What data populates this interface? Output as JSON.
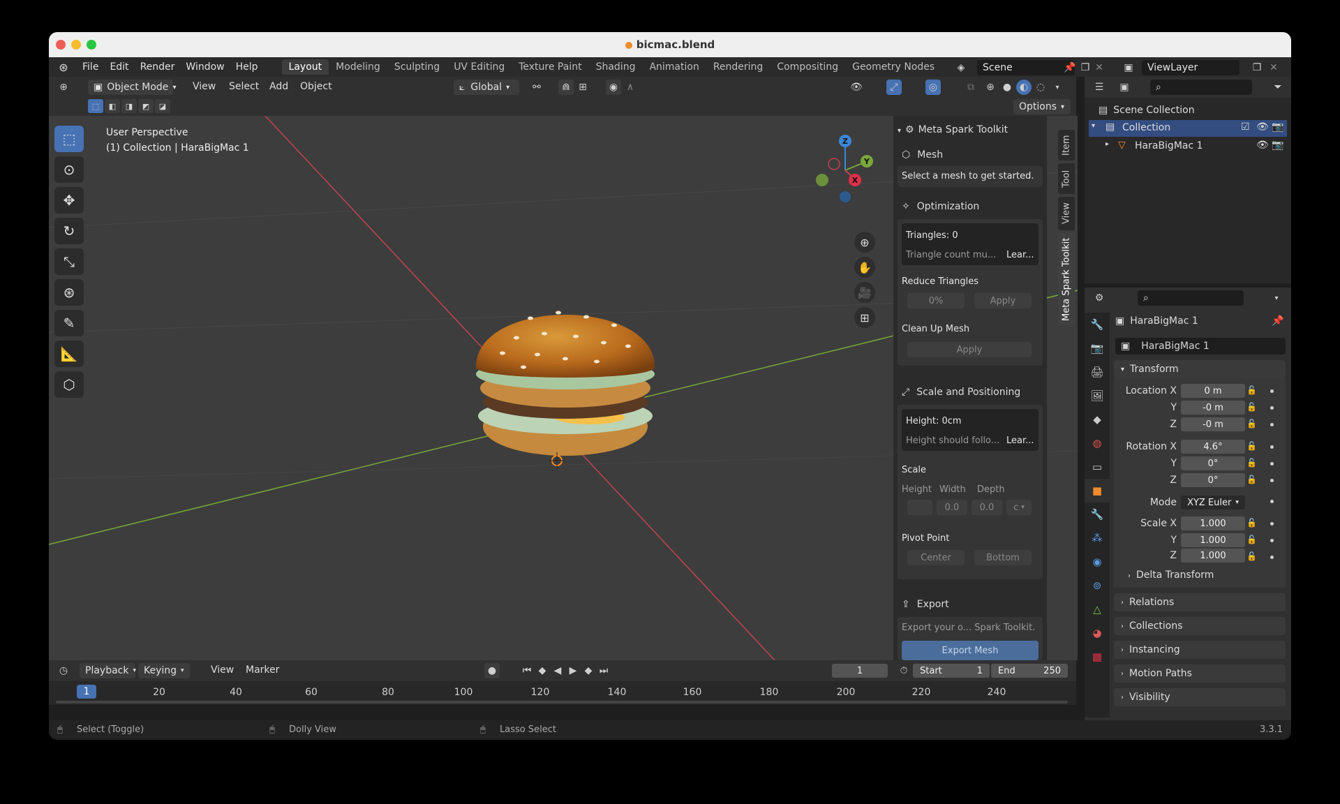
{
  "window": {
    "title": "bicmac.blend"
  },
  "menu": [
    "File",
    "Edit",
    "Render",
    "Window",
    "Help"
  ],
  "workspaces": [
    "Layout",
    "Modeling",
    "Sculpting",
    "UV Editing",
    "Texture Paint",
    "Shading",
    "Animation",
    "Rendering",
    "Compositing",
    "Geometry Nodes"
  ],
  "scene": "Scene",
  "view_layer": "ViewLayer",
  "viewport": {
    "mode": "Object Mode",
    "menus": [
      "View",
      "Select",
      "Add",
      "Object"
    ],
    "orientation": "Global",
    "options": "Options",
    "perspective": "User Perspective",
    "collection_info": "(1) Collection | HaraBigMac 1",
    "axes": {
      "z": "Z",
      "y": "Y",
      "x": "X"
    }
  },
  "npanel": {
    "tabs": [
      "Item",
      "Tool",
      "View",
      "Meta Spark Toolkit"
    ],
    "title": "Meta Spark Toolkit",
    "mesh": {
      "label": "Mesh",
      "hint": "Select a mesh to get started."
    },
    "optimization": {
      "label": "Optimization",
      "triangles": "Triangles: 0",
      "triangle_hint": "Triangle count mu...",
      "learn": "Lear...",
      "reduce_label": "Reduce Triangles",
      "reduce_value": "0%",
      "apply": "Apply",
      "cleanup_label": "Clean Up Mesh"
    },
    "scale_positioning": {
      "label": "Scale and Positioning",
      "height": "Height: 0cm",
      "height_hint": "Height should follo...",
      "learn": "Lear...",
      "scale_label": "Scale",
      "cols": [
        "Height",
        "Width",
        "Depth"
      ],
      "val_w": "0.0",
      "val_d": "0.0",
      "unit": "c",
      "pivot_label": "Pivot Point",
      "pivot_center": "Center",
      "pivot_bottom": "Bottom"
    },
    "export": {
      "label": "Export",
      "hint": "Export your o... Spark Toolkit.",
      "button": "Export Mesh"
    }
  },
  "outliner": {
    "root": "Scene Collection",
    "collection": "Collection",
    "object": "HaraBigMac 1"
  },
  "properties": {
    "object_name": "HaraBigMac 1",
    "datablock": "HaraBigMac 1",
    "transform_label": "Transform",
    "location_label": "Location X",
    "loc": [
      "0 m",
      "-0 m",
      "-0 m"
    ],
    "rotation_label": "Rotation X",
    "rot": [
      "4.6°",
      "0°",
      "0°"
    ],
    "mode_label": "Mode",
    "mode_value": "XYZ Euler",
    "scale_label": "Scale X",
    "scale": [
      "1.000",
      "1.000",
      "1.000"
    ],
    "axis_y": "Y",
    "axis_z": "Z",
    "delta": "Delta Transform",
    "panels": [
      "Relations",
      "Collections",
      "Instancing",
      "Motion Paths",
      "Visibility"
    ]
  },
  "timeline": {
    "menus": [
      "Playback",
      "Keying",
      "View",
      "Marker"
    ],
    "current_frame": "1",
    "start_label": "Start",
    "start": "1",
    "end_label": "End",
    "end": "250",
    "ticks": [
      "20",
      "40",
      "60",
      "80",
      "100",
      "120",
      "140",
      "160",
      "180",
      "200",
      "220",
      "240"
    ],
    "marker": "1"
  },
  "status": {
    "left": "Select (Toggle)",
    "middle": "Dolly View",
    "right": "Lasso Select",
    "version": "3.3.1"
  },
  "colors": {
    "accent": "#4772b3",
    "x_axis": "#c2424f",
    "y_axis": "#7aa83a",
    "z_axis": "#3c87d6"
  }
}
